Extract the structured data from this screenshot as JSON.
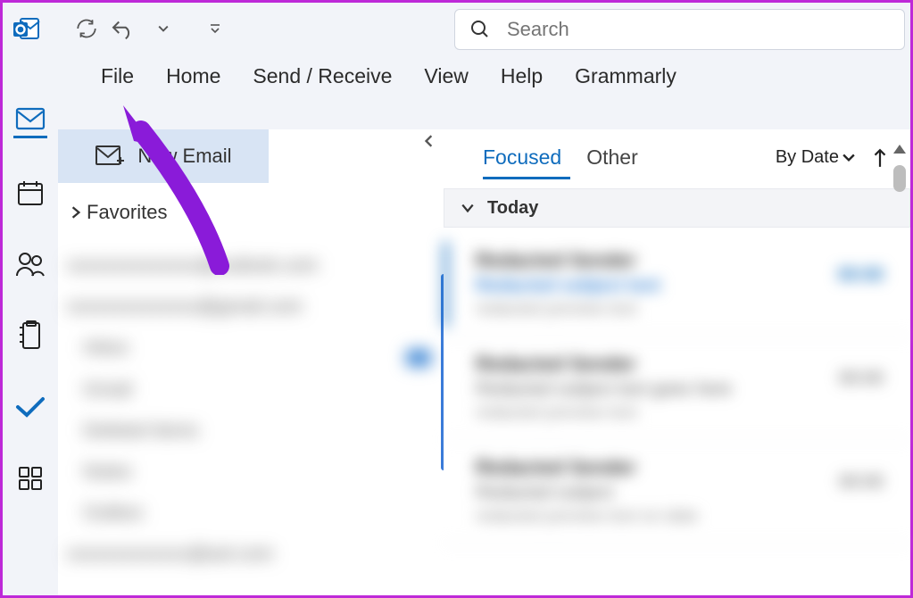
{
  "title_bar": {
    "app": "Outlook"
  },
  "search": {
    "placeholder": "Search"
  },
  "ribbon": {
    "tabs": [
      "File",
      "Home",
      "Send / Receive",
      "View",
      "Help",
      "Grammarly"
    ]
  },
  "new_email_label": "New Email",
  "favorites_label": "Favorites",
  "message_tabs": {
    "focused": "Focused",
    "other": "Other",
    "sort_label": "By Date"
  },
  "group_today": "Today",
  "rail": {
    "items": [
      "mail",
      "calendar",
      "people",
      "notes",
      "todo",
      "apps"
    ]
  },
  "icons": {
    "refresh": "refresh-icon",
    "undo": "undo-icon",
    "customize": "customize-icon",
    "search": "search-icon",
    "chevron_left": "chevron-left-icon",
    "chevron_down": "chevron-down-icon",
    "chevron_right": "chevron-right-icon",
    "arrow_up": "arrow-up-icon",
    "new_mail": "new-mail-icon",
    "mail": "mail-icon",
    "calendar": "calendar-icon",
    "people": "people-icon",
    "note": "note-icon",
    "check": "todo-check-icon",
    "grid": "more-apps-icon",
    "scroll_up": "scroll-up-icon"
  },
  "blurred_placeholders": {
    "accounts": [
      "xxxxxxxxxxxxxx@outlook.com",
      "xxxxxxxxxxxxxx@gmail.com",
      "Inbox",
      "Gmail",
      "Deleted Items",
      "Notes",
      "Outbox",
      "xxxxxxxxxxxxx@aol.com"
    ],
    "messages": [
      {
        "from": "Redacted Sender",
        "subject": "Redacted subject text",
        "preview": "redacted preview text",
        "time": "00:00",
        "accent": true
      },
      {
        "from": "Redacted Sender",
        "subject": "Redacted subject text goes here",
        "preview": "redacted preview text",
        "time": "00:00",
        "accent": false
      },
      {
        "from": "Redacted Sender",
        "subject": "Redacted subject",
        "preview": "redacted preview text on date",
        "time": "00:00",
        "accent": false
      }
    ]
  }
}
